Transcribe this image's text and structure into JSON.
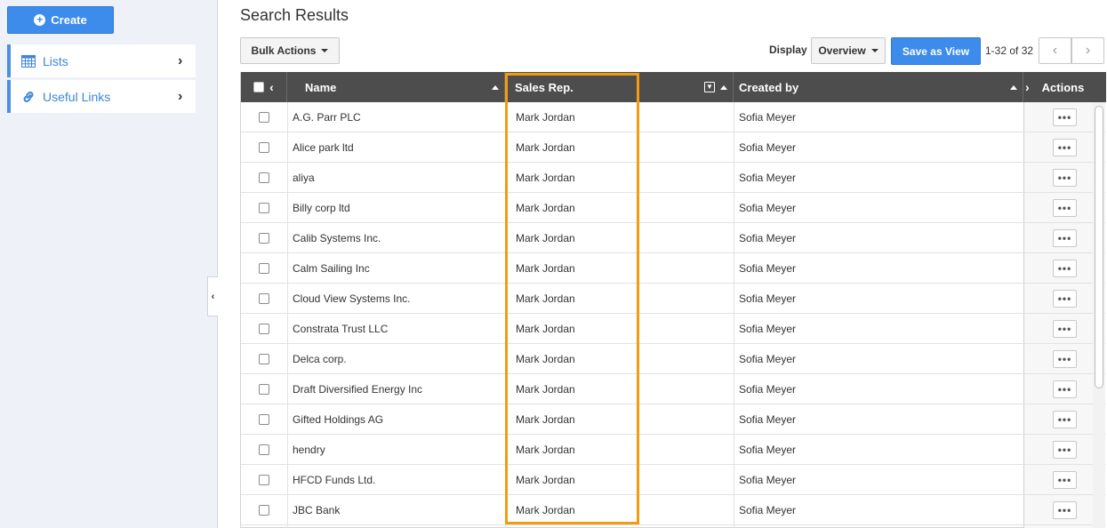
{
  "sidebar": {
    "create_label": "Create",
    "items": [
      {
        "label": "Lists",
        "icon": "calendar-grid-icon"
      },
      {
        "label": "Useful Links",
        "icon": "link-icon"
      }
    ]
  },
  "main": {
    "title": "Search Results",
    "bulk_actions_label": "Bulk Actions",
    "display_label": "Display",
    "display_value": "Overview",
    "save_view_label": "Save as View",
    "pager_text": "1-32 of 32",
    "pager_prev": "‹",
    "pager_next": "›"
  },
  "table": {
    "columns": [
      "Name",
      "Sales Rep.",
      "Created by",
      "Actions"
    ],
    "rows": [
      {
        "name": "A.G. Parr PLC",
        "sales_rep": "Mark Jordan",
        "created_by": "Sofia Meyer"
      },
      {
        "name": "Alice park ltd",
        "sales_rep": "Mark Jordan",
        "created_by": "Sofia Meyer"
      },
      {
        "name": "aliya",
        "sales_rep": "Mark Jordan",
        "created_by": "Sofia Meyer"
      },
      {
        "name": "Billy corp ltd",
        "sales_rep": "Mark Jordan",
        "created_by": "Sofia Meyer"
      },
      {
        "name": "Calib Systems Inc.",
        "sales_rep": "Mark Jordan",
        "created_by": "Sofia Meyer"
      },
      {
        "name": "Calm Sailing Inc",
        "sales_rep": "Mark Jordan",
        "created_by": "Sofia Meyer"
      },
      {
        "name": "Cloud View Systems Inc.",
        "sales_rep": "Mark Jordan",
        "created_by": "Sofia Meyer"
      },
      {
        "name": "Constrata Trust LLC",
        "sales_rep": "Mark Jordan",
        "created_by": "Sofia Meyer"
      },
      {
        "name": "Delca corp.",
        "sales_rep": "Mark Jordan",
        "created_by": "Sofia Meyer"
      },
      {
        "name": "Draft Diversified Energy Inc",
        "sales_rep": "Mark Jordan",
        "created_by": "Sofia Meyer"
      },
      {
        "name": "Gifted Holdings AG",
        "sales_rep": "Mark Jordan",
        "created_by": "Sofia Meyer"
      },
      {
        "name": "hendry",
        "sales_rep": "Mark Jordan",
        "created_by": "Sofia Meyer"
      },
      {
        "name": "HFCD Funds Ltd.",
        "sales_rep": "Mark Jordan",
        "created_by": "Sofia Meyer"
      },
      {
        "name": "JBC Bank",
        "sales_rep": "Mark Jordan",
        "created_by": "Sofia Meyer"
      }
    ],
    "row_action_label": "•••"
  },
  "colors": {
    "accent": "#3d8bea",
    "header_bg": "#4d4d4d",
    "highlight": "#f39c12"
  }
}
